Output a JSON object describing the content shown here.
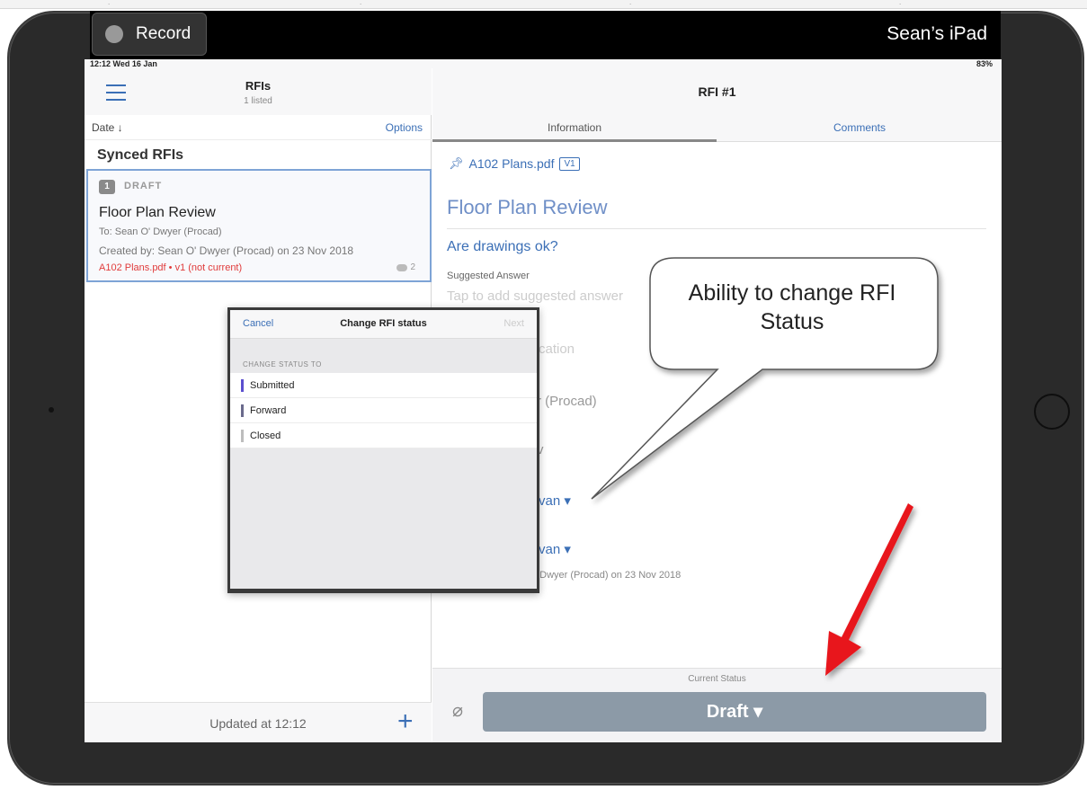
{
  "recorder": {
    "record_label": "Record",
    "device_name": "Sean’s iPad"
  },
  "statusbar": {
    "time": "12:12 Wed 16 Jan",
    "battery": "83%"
  },
  "left_pane": {
    "title": "RFIs",
    "subtitle": "1 listed",
    "sort_label": "Date ↓",
    "options_label": "Options",
    "group_title": "Synced RFIs",
    "card": {
      "number": "1",
      "status": "DRAFT",
      "title": "Floor Plan Review",
      "to": "To: Sean O' Dwyer (Procad)",
      "created": "Created by: Sean O' Dwyer (Procad) on 23 Nov 2018",
      "file": "A102 Plans.pdf • v1 (not current)",
      "comment_count": "2"
    },
    "footer_text": "Updated at 12:12",
    "plus_label": "+"
  },
  "right_pane": {
    "title": "RFI #1",
    "tabs": [
      "Information",
      "Comments"
    ],
    "file_name": "A102 Plans.pdf",
    "file_version": "V1",
    "heading": "Floor Plan Review",
    "question": "Are drawings ok?",
    "suggested_label": "Suggested Answer",
    "suggested_placeholder": "Tap to add suggested answer",
    "fragments": {
      "location": "cation",
      "procad": "r (Procad)",
      "v": "v",
      "assignee1": "van ▾",
      "assignee2": "van ▾",
      "created": "' Dwyer (Procad) on 23 Nov 2018"
    },
    "current_status_label": "Current Status",
    "draft_button": "Draft ▾"
  },
  "modal": {
    "cancel": "Cancel",
    "title": "Change RFI status",
    "next": "Next",
    "section_label": "CHANGE STATUS TO",
    "options": [
      {
        "label": "Submitted",
        "color": "#5b4fcf"
      },
      {
        "label": "Forward",
        "color": "#6a6a8c"
      },
      {
        "label": "Closed",
        "color": "#bdbdbd"
      }
    ]
  },
  "callout": {
    "text_line1": "Ability to change RFI",
    "text_line2": "Status"
  },
  "colors": {
    "accent": "#3b6fb6",
    "arrow": "#e8141c",
    "bezel": "#2a2a2a",
    "draft_button": "#8c9aa7"
  }
}
